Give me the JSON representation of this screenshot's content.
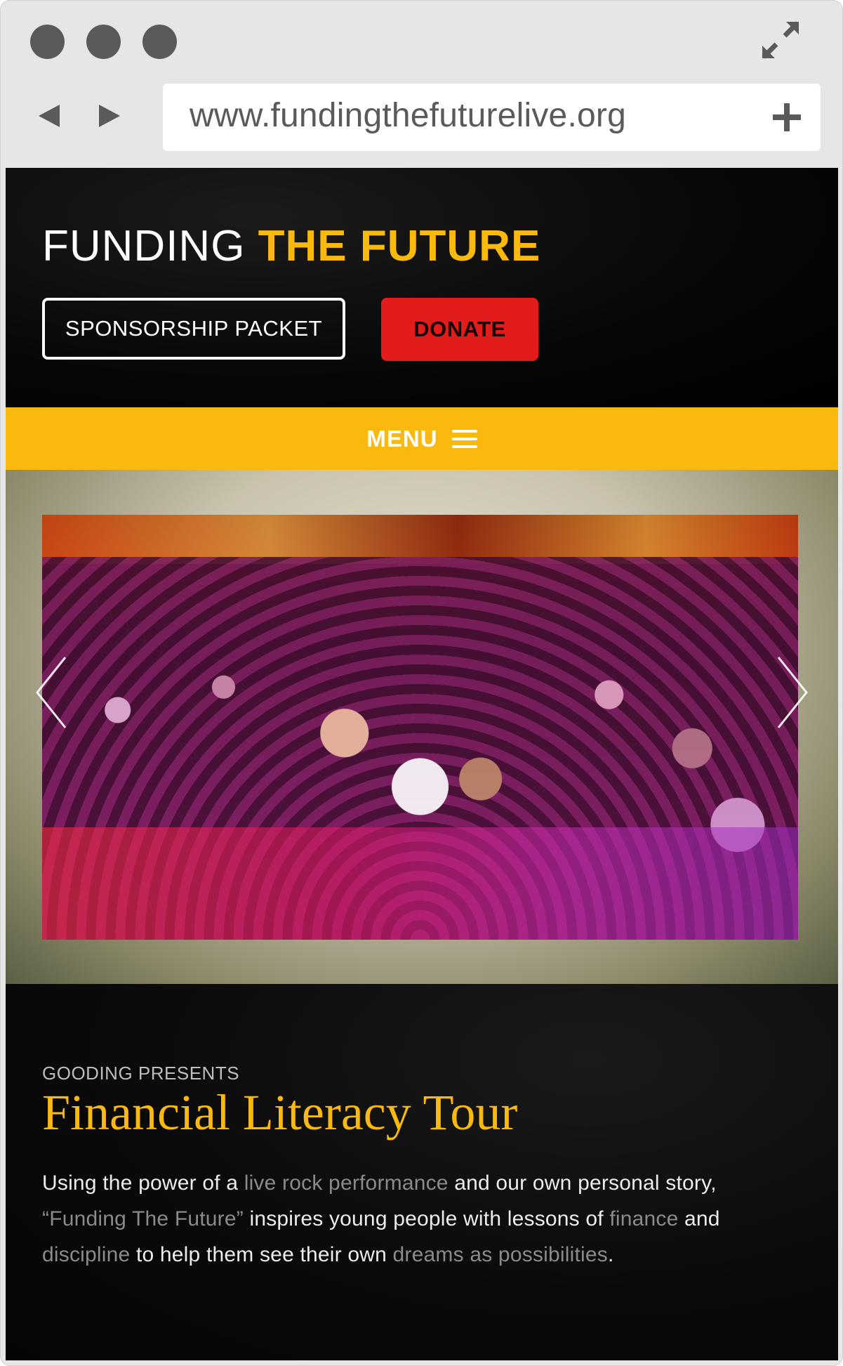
{
  "browser": {
    "url": "www.fundingthefuturelive.org",
    "window_dots": [
      "close",
      "minimize",
      "maximize"
    ],
    "icons": {
      "back": "back-arrow-icon",
      "forward": "forward-arrow-icon",
      "expand": "expand-icon",
      "new_tab": "plus-icon"
    }
  },
  "header": {
    "logo_part1": "FUNDING ",
    "logo_part2": "THE FUTURE",
    "sponsor_button": "SPONSORSHIP PACKET",
    "donate_button": "DONATE"
  },
  "nav": {
    "menu_label": "MENU"
  },
  "hero": {
    "prev_icon": "chevron-left-icon",
    "next_icon": "chevron-right-icon"
  },
  "content": {
    "eyebrow": "GOODING PRESENTS",
    "title": "Financial Literacy Tour",
    "paragraph": {
      "t1": "Using the power of a ",
      "h1": "live rock performance",
      "t2": " and our own personal story, ",
      "h2": "“Funding The Future”",
      "t3": " inspires young people with lessons of ",
      "h3": "finance",
      "t4": " and ",
      "h4": "discipline",
      "t5": " to help them see their own ",
      "h5": "dreams as possibilities",
      "t6": "."
    }
  },
  "colors": {
    "accent_yellow": "#f9b90d",
    "donate_red": "#e21b1b",
    "page_black": "#000000",
    "chrome_gray": "#e6e6e6"
  }
}
